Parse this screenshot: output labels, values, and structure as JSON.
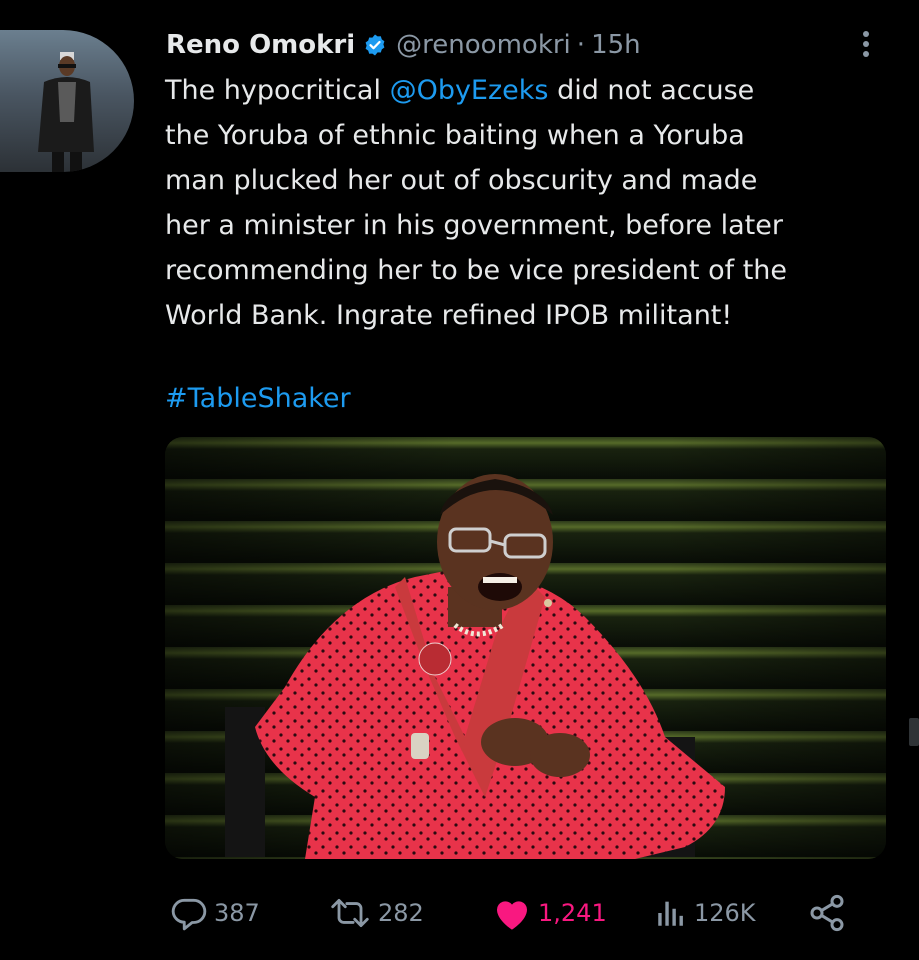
{
  "tweet": {
    "author_name": "Reno Omokri",
    "handle": "@renoomokri",
    "separator": "·",
    "time": "15h",
    "text_lines": [
      {
        "before": "The hypocritical ",
        "mention": "@ObyEzeks",
        "after": " did not accuse"
      },
      {
        "text": "the Yoruba of ethnic baiting when a Yoruba"
      },
      {
        "text": "man plucked her out of obscurity and made"
      },
      {
        "text": "her a minister in his government, before later"
      },
      {
        "text": "recommending her to be vice president of the"
      },
      {
        "text": "World Bank. Ingrate refined IPOB militant!"
      }
    ],
    "hashtag": "#TableShaker"
  },
  "actions": {
    "replies": "387",
    "retweets": "282",
    "likes": "1,241",
    "views": "126K"
  },
  "icons": [
    "verified-badge-icon",
    "more-icon",
    "reply-icon",
    "retweet-icon",
    "heart-icon",
    "views-icon",
    "share-icon"
  ],
  "colors": {
    "background": "#000000",
    "text": "#e7e9ea",
    "muted": "#8b98a5",
    "link": "#1d9bf0",
    "like": "#f91880"
  }
}
